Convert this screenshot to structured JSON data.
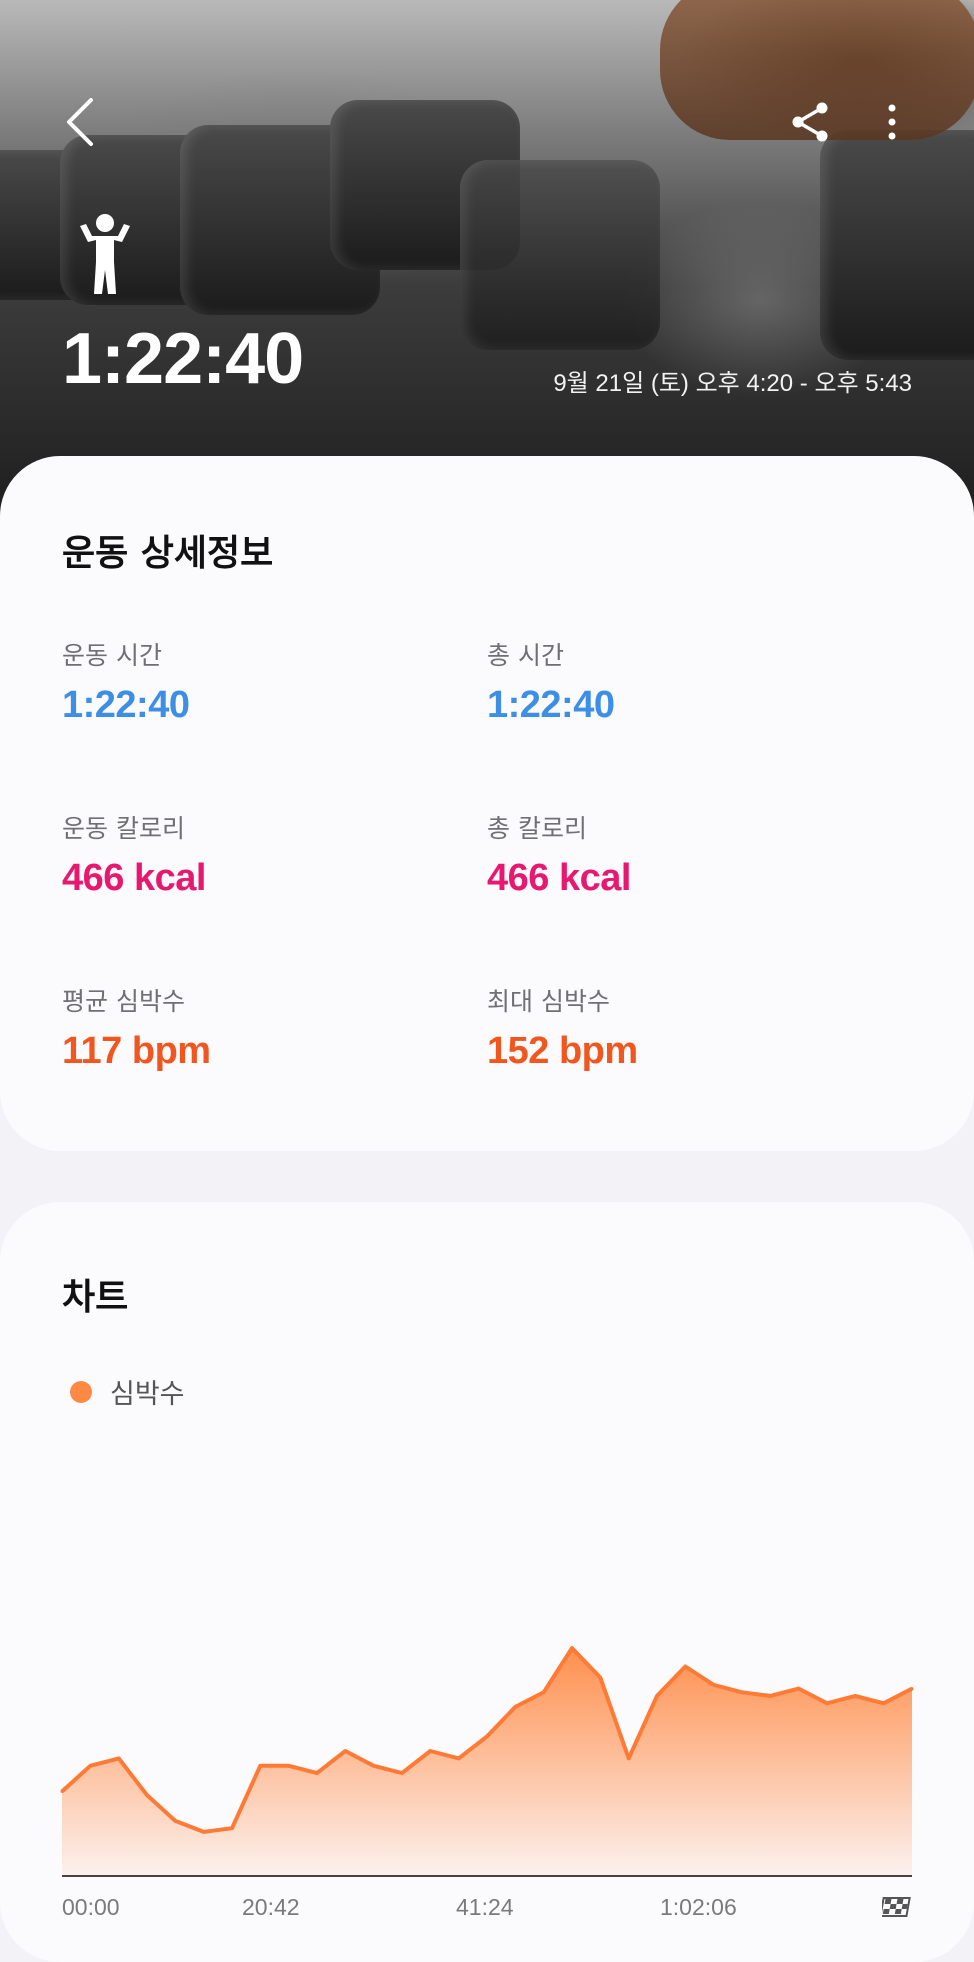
{
  "header": {
    "back_icon": "back-arrow-icon",
    "share_icon": "share-icon",
    "more_icon": "more-vertical-icon"
  },
  "hero": {
    "exercise_icon": "weightlifting-person-icon",
    "duration": "1:22:40",
    "date_range": "9월 21일 (토) 오후 4:20 - 오후 5:43"
  },
  "details": {
    "title": "운동 상세정보",
    "metrics": [
      {
        "label": "운동 시간",
        "value": "1:22:40",
        "color": "#3d8fe6"
      },
      {
        "label": "총 시간",
        "value": "1:22:40",
        "color": "#3d8fe6"
      },
      {
        "label": "운동 칼로리",
        "value": "466 kcal",
        "color": "#e8176f"
      },
      {
        "label": "총 칼로리",
        "value": "466 kcal",
        "color": "#e8176f"
      },
      {
        "label": "평균 심박수",
        "value": "117 bpm",
        "color": "#f0561e"
      },
      {
        "label": "최대 심박수",
        "value": "152 bpm",
        "color": "#f0561e"
      }
    ]
  },
  "chart": {
    "title": "차트",
    "legend_label": "심박수",
    "legend_color": "#ff8a45",
    "finish_icon": "checkered-flag-icon"
  },
  "chart_data": {
    "type": "area",
    "series": [
      {
        "name": "심박수",
        "x": [
          "00:00",
          "02:45",
          "05:30",
          "08:16",
          "11:01",
          "13:46",
          "16:32",
          "19:17",
          "22:02",
          "24:48",
          "27:33",
          "30:18",
          "33:04",
          "35:49",
          "38:34",
          "41:20",
          "44:05",
          "46:50",
          "49:36",
          "52:21",
          "55:06",
          "57:52",
          "1:00:37",
          "1:03:22",
          "1:06:08",
          "1:08:53",
          "1:11:38",
          "1:14:24",
          "1:17:09",
          "1:19:54",
          "1:22:40"
        ],
        "values": [
          103,
          110,
          112,
          102,
          95,
          92,
          93,
          110,
          110,
          108,
          114,
          110,
          108,
          114,
          112,
          118,
          126,
          130,
          142,
          134,
          112,
          129,
          137,
          132,
          130,
          129,
          131,
          127,
          129,
          127,
          131
        ]
      }
    ],
    "x_ticks": [
      "00:00",
      "20:42",
      "41:24",
      "1:02:06"
    ],
    "ylim": [
      80,
      160
    ],
    "grid": false
  }
}
